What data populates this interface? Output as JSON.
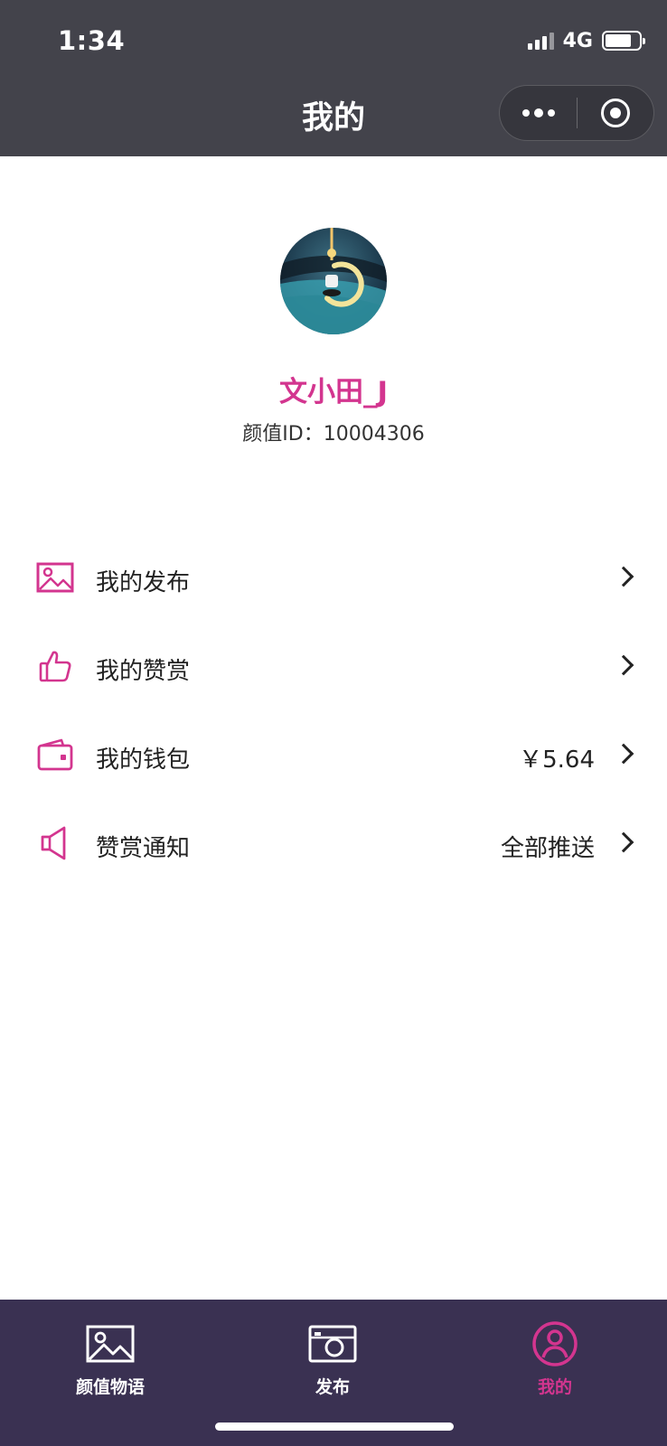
{
  "status_bar": {
    "time": "1:34",
    "network": "4G"
  },
  "nav": {
    "title": "我的"
  },
  "profile": {
    "username": "文小田_J",
    "id_text": "颜值ID：10004306"
  },
  "menu": {
    "items": [
      {
        "icon": "picture-icon",
        "label": "我的发布",
        "value": ""
      },
      {
        "icon": "thumbs-up-icon",
        "label": "我的赞赏",
        "value": ""
      },
      {
        "icon": "wallet-icon",
        "label": "我的钱包",
        "value": "￥5.64"
      },
      {
        "icon": "speaker-icon",
        "label": "赞赏通知",
        "value": "全部推送"
      }
    ]
  },
  "tabbar": {
    "tabs": [
      {
        "icon": "picture-icon",
        "label": "颜值物语",
        "active": false
      },
      {
        "icon": "camera-icon",
        "label": "发布",
        "active": false
      },
      {
        "icon": "user-icon",
        "label": "我的",
        "active": true
      }
    ]
  },
  "colors": {
    "accent": "#d3358f",
    "topbar_bg": "#43434b",
    "tabbar_bg": "#3a3152"
  }
}
